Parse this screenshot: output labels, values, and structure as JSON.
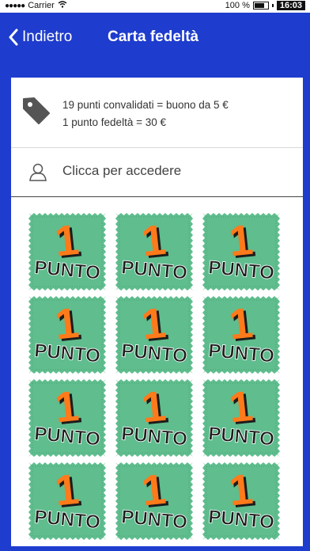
{
  "status_bar": {
    "carrier": "Carrier",
    "battery_percent": "100 %",
    "time": "16:03"
  },
  "nav": {
    "back_label": "Indietro",
    "title": "Carta fedeltà"
  },
  "info": {
    "line1": "19 punti convalidati = buono da 5 €",
    "line2": "1 punto fedeltà = 30 €"
  },
  "login": {
    "label": "Clicca per accedere"
  },
  "stamp": {
    "number": "1",
    "word": "PUNTO",
    "count": 12,
    "columns": 3,
    "colors": {
      "background": "#5fbd8e",
      "number": "#ff7a1a",
      "text": "#1c1c1c"
    }
  },
  "colors": {
    "nav": "#1e3ccd",
    "card": "#ffffff"
  }
}
